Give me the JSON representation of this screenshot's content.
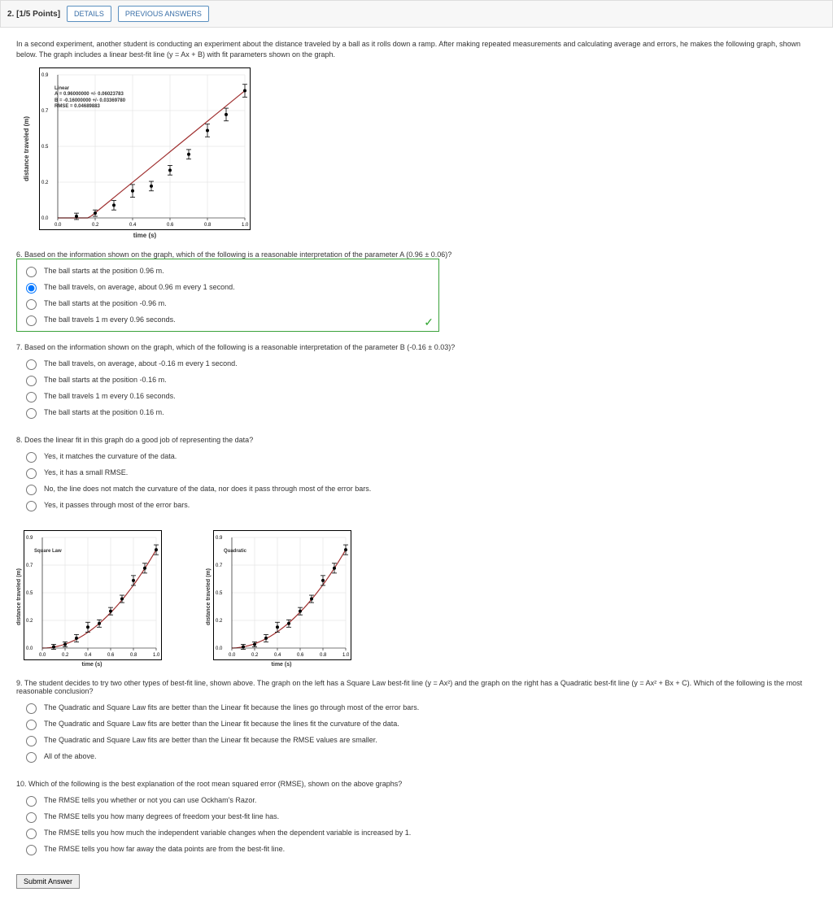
{
  "header": {
    "qnum": "2.",
    "points": "[1/5 Points]",
    "details": "DETAILS",
    "prev": "PREVIOUS ANSWERS"
  },
  "intro": "In a second experiment, another student is conducting an experiment about the distance traveled by a ball as it rolls down a ramp. After making repeated measurements and calculating average and errors, he makes the following graph, shown below. The graph includes a linear best-fit line (y = Ax + B) with fit parameters shown on the graph.",
  "graph1": {
    "ylabel": "distance traveled  (m)",
    "xlabel": "time  (s)",
    "fit_title": "Linear",
    "fitA": "A = 0.96000000 +/- 0.06023783",
    "fitB": "B = -0.16000000 +/- 0.03369780",
    "fitR": "RMSE = 0.04689883"
  },
  "q6": {
    "prompt": "6. Based on the information shown on the graph, which of the following is a reasonable interpretation of the parameter A (0.96 ± 0.06)?",
    "options": [
      "The ball starts at the position 0.96 m.",
      "The ball travels, on average, about 0.96 m every 1 second.",
      "The ball starts at the position -0.96 m.",
      "The ball travels 1 m every 0.96 seconds."
    ],
    "selected": 1
  },
  "q7": {
    "prompt": "7. Based on the information shown on the graph, which of the following is a reasonable interpretation of the parameter B (-0.16 ± 0.03)?",
    "options": [
      "The ball travels, on average, about -0.16 m every 1 second.",
      "The ball starts at the position -0.16 m.",
      "The ball travels 1 m every 0.16 seconds.",
      "The ball starts at the position 0.16 m."
    ]
  },
  "q8": {
    "prompt": "8. Does the linear fit in this graph do a good job of representing the data?",
    "options": [
      "Yes, it matches the curvature of the data.",
      "Yes, it has a small RMSE.",
      "No, the line does not match the curvature of the data, nor does it pass through most of the error bars.",
      "Yes, it passes through most of the error bars."
    ]
  },
  "small_graph_ylabel": "distance traveled  (m)",
  "small_graph_xlabel": "time  (s)",
  "sglabels": {
    "left_title": "Square Law",
    "right_title": "Quadratic"
  },
  "q9": {
    "prompt": "9. The student decides to try two other types of best-fit line, shown above. The graph on the left has a Square Law best-fit line (y = Ax²) and the graph on the right has a Quadratic best-fit line (y = Ax² + Bx + C). Which of the following is the most reasonable conclusion?",
    "options": [
      "The Quadratic and Square Law fits are better than the Linear fit because the lines go through most of the error bars.",
      "The Quadratic and Square Law fits are better than the Linear fit because the lines fit the curvature of the data.",
      "The Quadratic and Square Law fits are better than the Linear fit because the RMSE values are smaller.",
      "All of the above."
    ]
  },
  "q10": {
    "prompt": "10. Which of the following is the best explanation of the root mean squared error (RMSE), shown on the above graphs?",
    "options": [
      "The RMSE tells you whether or not you can use Ockham's Razor.",
      "The RMSE tells you how many degrees of freedom your best-fit line has.",
      "The RMSE tells you how much the independent variable changes when the dependent variable is increased by 1.",
      "The RMSE tells you how far away the data points are from the best-fit line."
    ]
  },
  "submit": "Submit Answer",
  "chart_data": [
    {
      "type": "scatter",
      "title": "Linear fit",
      "xlabel": "time (s)",
      "ylabel": "distance traveled (m)",
      "xlim": [
        0,
        1.0
      ],
      "ylim": [
        0,
        0.9
      ],
      "x": [
        0.1,
        0.2,
        0.3,
        0.4,
        0.5,
        0.6,
        0.7,
        0.8,
        0.9,
        1.0
      ],
      "y": [
        0.01,
        0.03,
        0.08,
        0.17,
        0.2,
        0.3,
        0.4,
        0.55,
        0.65,
        0.8
      ],
      "yerr": [
        0.02,
        0.02,
        0.03,
        0.04,
        0.03,
        0.03,
        0.03,
        0.04,
        0.04,
        0.04
      ],
      "fit": {
        "type": "linear",
        "A": 0.96,
        "B": -0.16
      }
    },
    {
      "type": "scatter",
      "title": "Square Law fit",
      "xlabel": "time (s)",
      "ylabel": "distance traveled (m)",
      "xlim": [
        0,
        1.0
      ],
      "ylim": [
        0,
        0.9
      ],
      "x": [
        0.1,
        0.2,
        0.3,
        0.4,
        0.5,
        0.6,
        0.7,
        0.8,
        0.9,
        1.0
      ],
      "y": [
        0.01,
        0.03,
        0.08,
        0.17,
        0.2,
        0.3,
        0.4,
        0.55,
        0.65,
        0.8
      ],
      "yerr": [
        0.02,
        0.02,
        0.03,
        0.04,
        0.03,
        0.03,
        0.03,
        0.04,
        0.04,
        0.04
      ],
      "fit": {
        "type": "square",
        "A": 0.8
      }
    },
    {
      "type": "scatter",
      "title": "Quadratic fit",
      "xlabel": "time (s)",
      "ylabel": "distance traveled (m)",
      "xlim": [
        0,
        1.0
      ],
      "ylim": [
        0,
        0.9
      ],
      "x": [
        0.1,
        0.2,
        0.3,
        0.4,
        0.5,
        0.6,
        0.7,
        0.8,
        0.9,
        1.0
      ],
      "y": [
        0.01,
        0.03,
        0.08,
        0.17,
        0.2,
        0.3,
        0.4,
        0.55,
        0.65,
        0.8
      ],
      "yerr": [
        0.02,
        0.02,
        0.03,
        0.04,
        0.03,
        0.03,
        0.03,
        0.04,
        0.04,
        0.04
      ],
      "fit": {
        "type": "quadratic",
        "A": 0.78,
        "B": 0.02,
        "C": 0.0
      }
    }
  ]
}
